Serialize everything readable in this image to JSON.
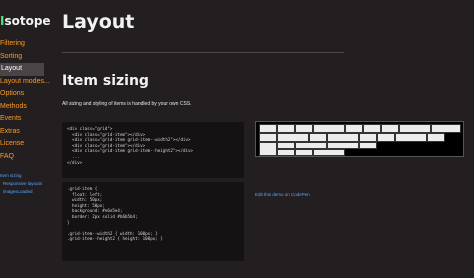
{
  "sidebar": {
    "logo_letter": "I",
    "logo_rest": "sotope",
    "nav": [
      {
        "label": "Filtering",
        "active": false
      },
      {
        "label": "Sorting",
        "active": false
      },
      {
        "label": "Layout",
        "active": true
      },
      {
        "label": "Layout modes...",
        "active": false
      },
      {
        "label": "Options",
        "active": false
      },
      {
        "label": "Methods",
        "active": false
      },
      {
        "label": "Events",
        "active": false
      },
      {
        "label": "Extras",
        "active": false
      },
      {
        "label": "License",
        "active": false
      },
      {
        "label": "FAQ",
        "active": false
      }
    ],
    "subnav": [
      {
        "label": "Item sizing"
      },
      {
        "label": "Responsive layouts"
      },
      {
        "label": "imagesLoaded"
      }
    ]
  },
  "page": {
    "title": "Layout",
    "section_title": "Item sizing",
    "lead": "All sizing and styling of items is handled by your own CSS."
  },
  "code_html": [
    "<div class=\"grid\">",
    "  <div class=\"grid-item\"></div>",
    "  <div class=\"grid-item grid-item--width2\"></div>",
    "  <div class=\"grid-item\"></div>",
    "  <div class=\"grid-item grid-item--height2\"></div>",
    "  ...",
    "</div>"
  ],
  "code_css": [
    ".grid-item {",
    "  float: left;",
    "  width: 50px;",
    "  height: 50px;",
    "  background: #e6e5e4;",
    "  border: 2px solid #b6b5b4;",
    "}",
    "",
    ".grid-item--width2 { width: 100px; }",
    ".grid-item--height2 { height: 100px; }"
  ],
  "demo": {
    "link": "Edit this demo on CodePen"
  },
  "colors": {
    "background": "#231f20",
    "nav_link": "#ff9922",
    "sub_link": "#59a3ff",
    "logo_accent": "#55dd77"
  }
}
